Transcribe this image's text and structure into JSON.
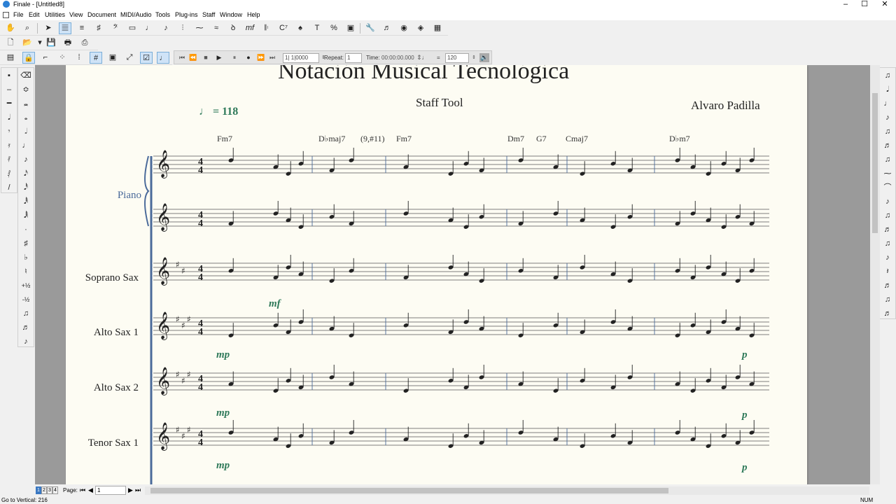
{
  "window": {
    "title": "Finale - [Untitled8]",
    "minimize": "–",
    "maximize": "☐",
    "close": "✕"
  },
  "menu": [
    "File",
    "Edit",
    "Utilities",
    "View",
    "Document",
    "MIDI/Audio",
    "Tools",
    "Plug-ins",
    "Staff",
    "Window",
    "Help"
  ],
  "playback": {
    "measure": "1| 1|0000",
    "repeat_label": "Repeat:",
    "repeat_value": "1",
    "time_label": "Time:",
    "time_value": "00:00:00.000",
    "tempo_value": "120"
  },
  "score": {
    "title": "Notación Musical Tecnológica",
    "subtitle": "Staff Tool",
    "composer": "Alvaro Padilla",
    "tempo_mark": "= 118",
    "chords": [
      "Fm7",
      "D♭maj7",
      "(9,#11)",
      "Fm7",
      "Dm7",
      "G7",
      "Cmaj7",
      "D♭m7"
    ],
    "instruments": [
      "Piano",
      "Soprano Sax",
      "Alto Sax 1",
      "Alto Sax 2",
      "Tenor Sax 1"
    ],
    "dynamics": {
      "soprano": [
        "mf"
      ],
      "alto1": [
        "mp",
        "p"
      ],
      "alto2": [
        "mp",
        "p"
      ],
      "tenor1": [
        "mp",
        "p"
      ]
    },
    "time_signature": "4/4"
  },
  "status": {
    "pages": [
      "1",
      "2",
      "3",
      "4"
    ],
    "page_label": "Page:",
    "page_value": "1",
    "message": "Go to Vertical: 216",
    "num": "NUM"
  },
  "colors": {
    "dynamic": "#2f7a5a",
    "page": "#fdfcf3",
    "doc_bg": "#9a9a9a",
    "selected_tool": "#cfe3f7"
  }
}
